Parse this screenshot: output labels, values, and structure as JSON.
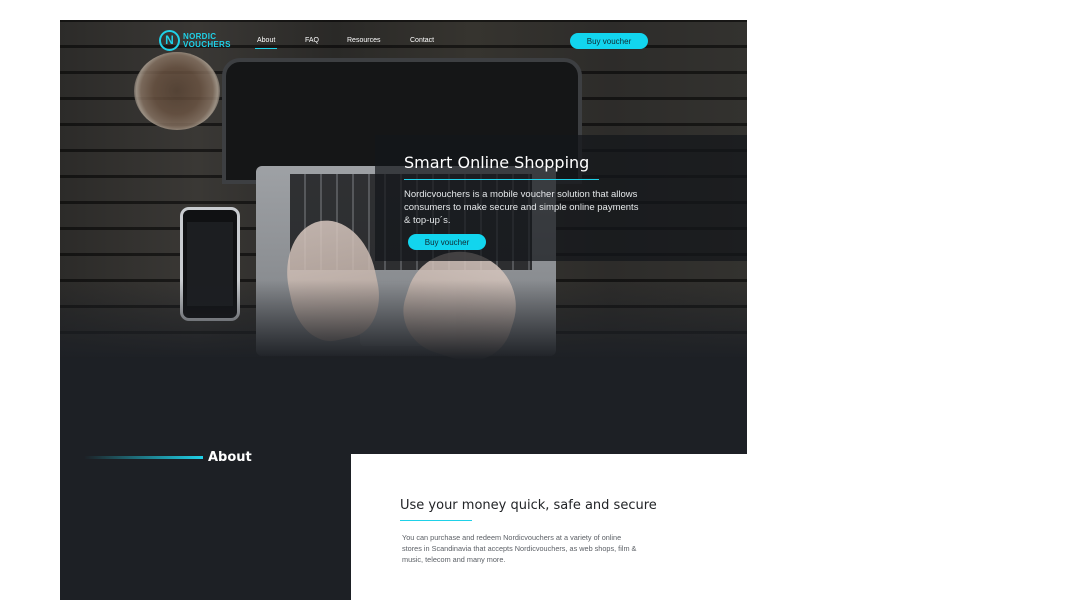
{
  "brand": {
    "line1": "NORDIC",
    "line2": "VOUCHERS",
    "badge": "N"
  },
  "nav": [
    {
      "label": "About",
      "active": true
    },
    {
      "label": "FAQ",
      "active": false
    },
    {
      "label": "Resources",
      "active": false
    },
    {
      "label": "Contact",
      "active": false
    }
  ],
  "header": {
    "cta_label": "Buy voucher"
  },
  "hero": {
    "title": "Smart Online Shopping",
    "text": "Nordicvouchers is a mobile voucher solution that allows consumers to make secure and simple online payments & top-up´s.",
    "cta_label": "Buy voucher"
  },
  "about": {
    "heading": "About",
    "subheading": "Use your money quick, safe and secure",
    "text": "You can purchase and redeem Nordicvouchers at a variety of online stores in Scandinavia that accepts Nordicvouchers, as web shops, film & music, telecom and many more."
  },
  "colors": {
    "accent": "#12d5ee",
    "dark_bg": "#1d2025",
    "panel_bg": "#ffffff"
  }
}
